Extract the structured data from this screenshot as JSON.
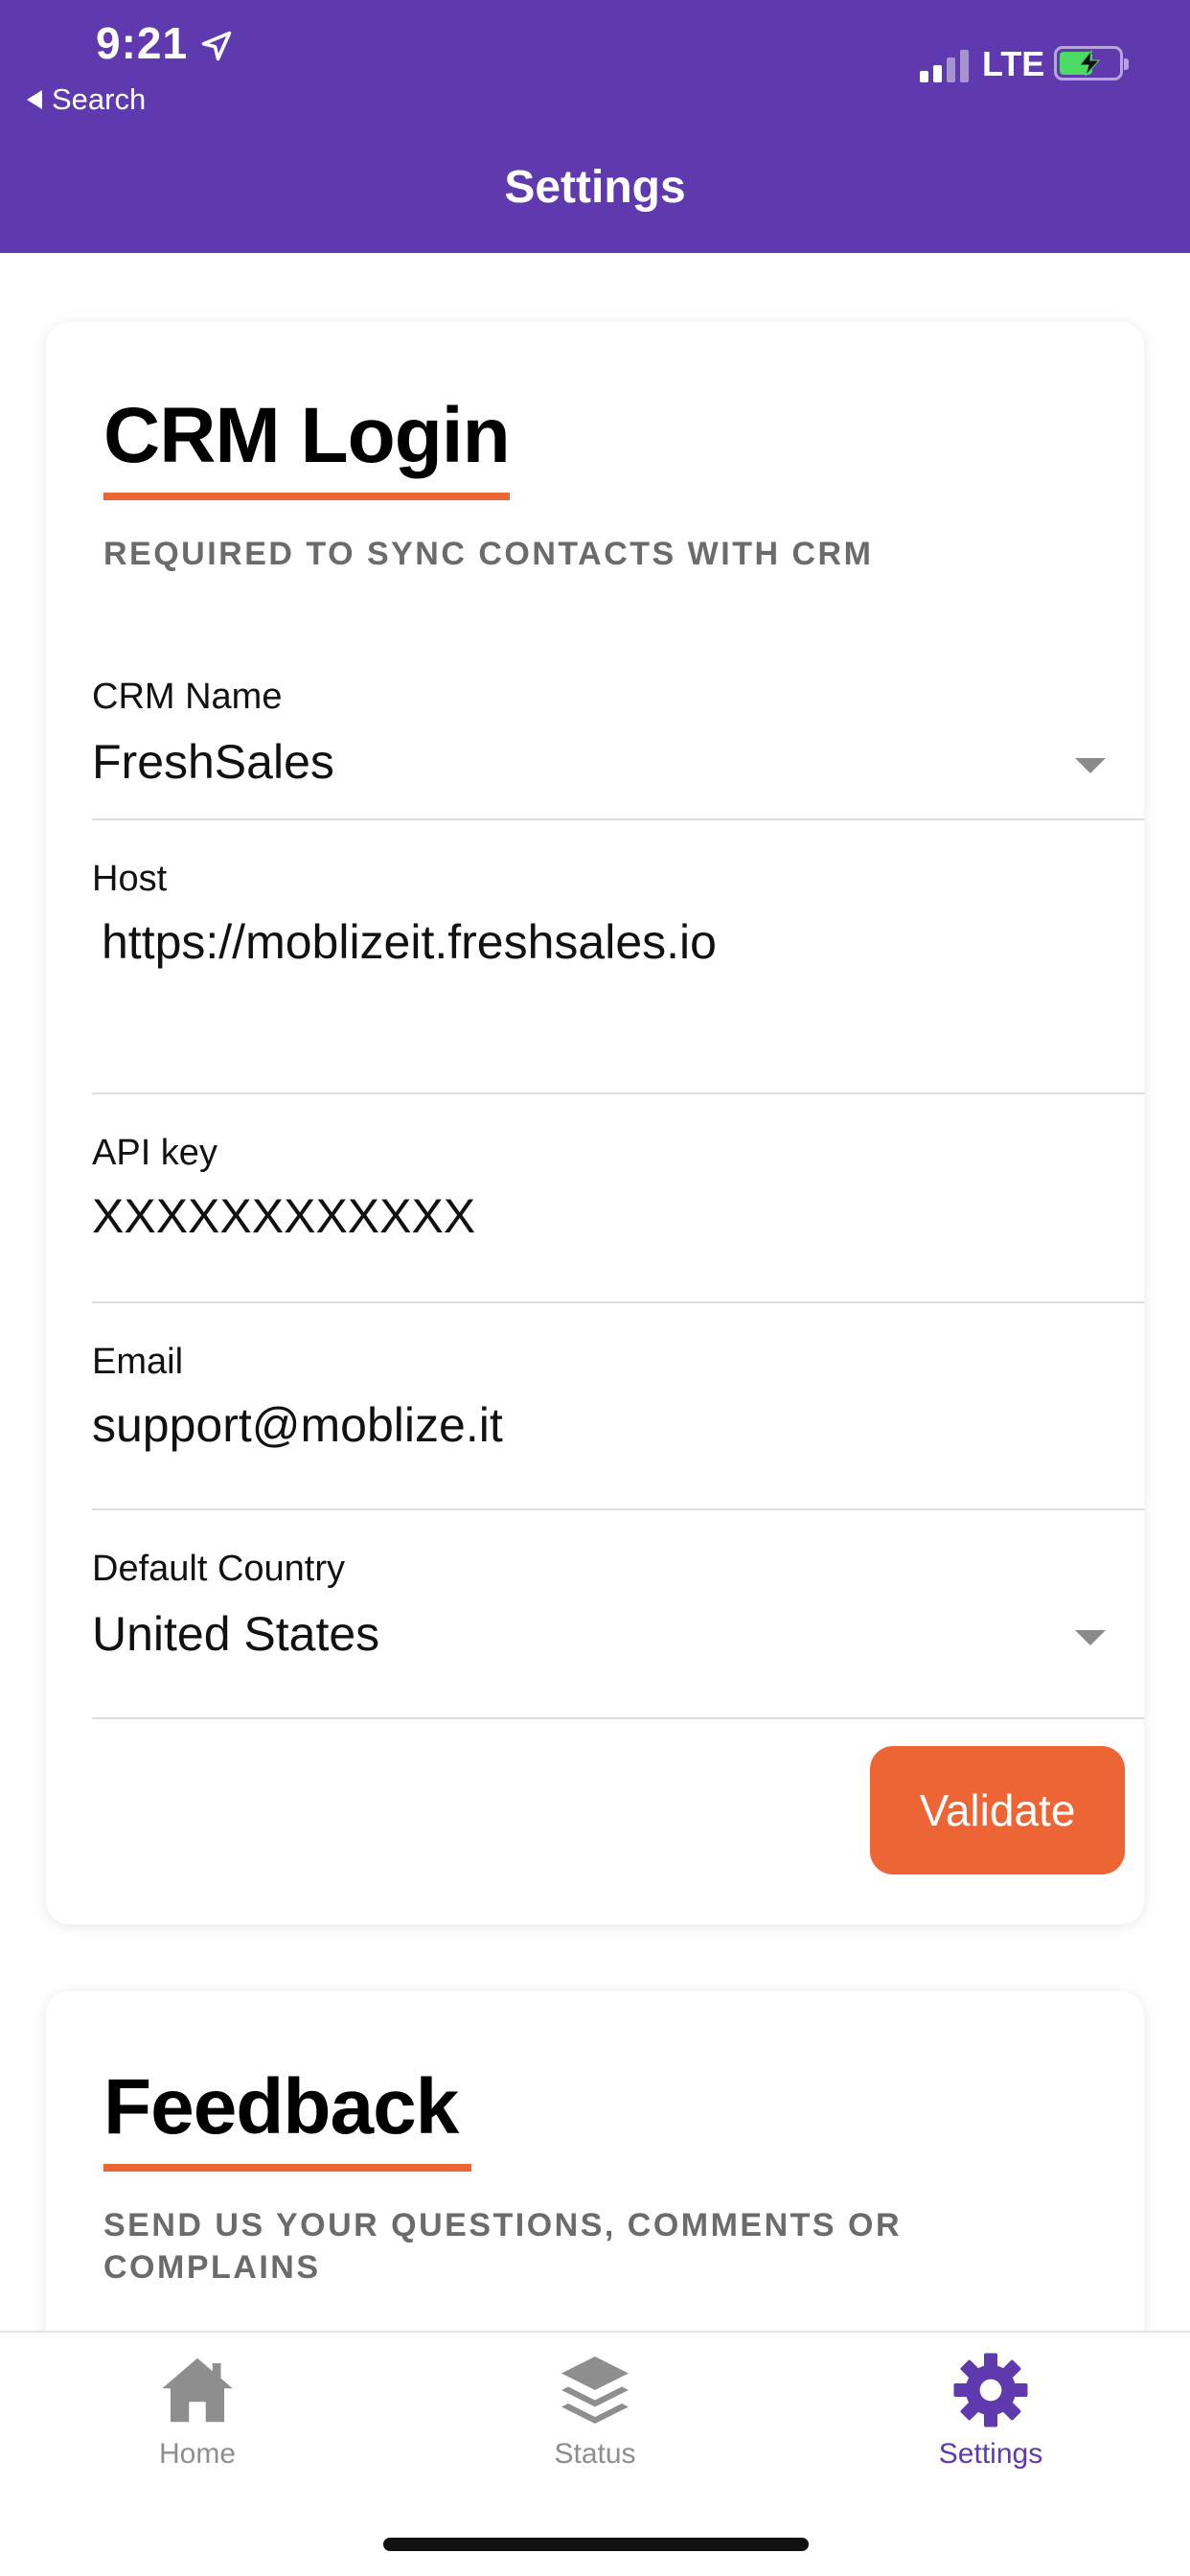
{
  "status_bar": {
    "time": "9:21",
    "back_label": "Search",
    "network": "LTE",
    "icons": [
      "location-arrow-icon",
      "signal-icon",
      "battery-charging-icon"
    ]
  },
  "header": {
    "title": "Settings",
    "background_color": "#5f39ae"
  },
  "crm_card": {
    "title": "CRM Login",
    "subtitle": "REQUIRED TO SYNC CONTACTS WITH CRM",
    "fields": {
      "crm_name": {
        "label": "CRM Name",
        "value": "FreshSales"
      },
      "host": {
        "label": "Host",
        "value": "https://moblizeit.freshsales.io"
      },
      "api_key": {
        "label": "API key",
        "value": "XXXXXXXXXXXX"
      },
      "email": {
        "label": "Email",
        "value": "support@moblize.it"
      },
      "default_country": {
        "label": "Default Country",
        "value": "United States"
      }
    },
    "validate_label": "Validate",
    "accent_color": "#ee6535"
  },
  "feedback_card": {
    "title": "Feedback",
    "subtitle": "SEND US YOUR QUESTIONS, COMMENTS OR COMPLAINS"
  },
  "tabbar": {
    "tabs": [
      {
        "label": "Home",
        "icon": "home-icon"
      },
      {
        "label": "Status",
        "icon": "layers-icon"
      },
      {
        "label": "Settings",
        "icon": "gear-icon",
        "active": true
      }
    ]
  }
}
